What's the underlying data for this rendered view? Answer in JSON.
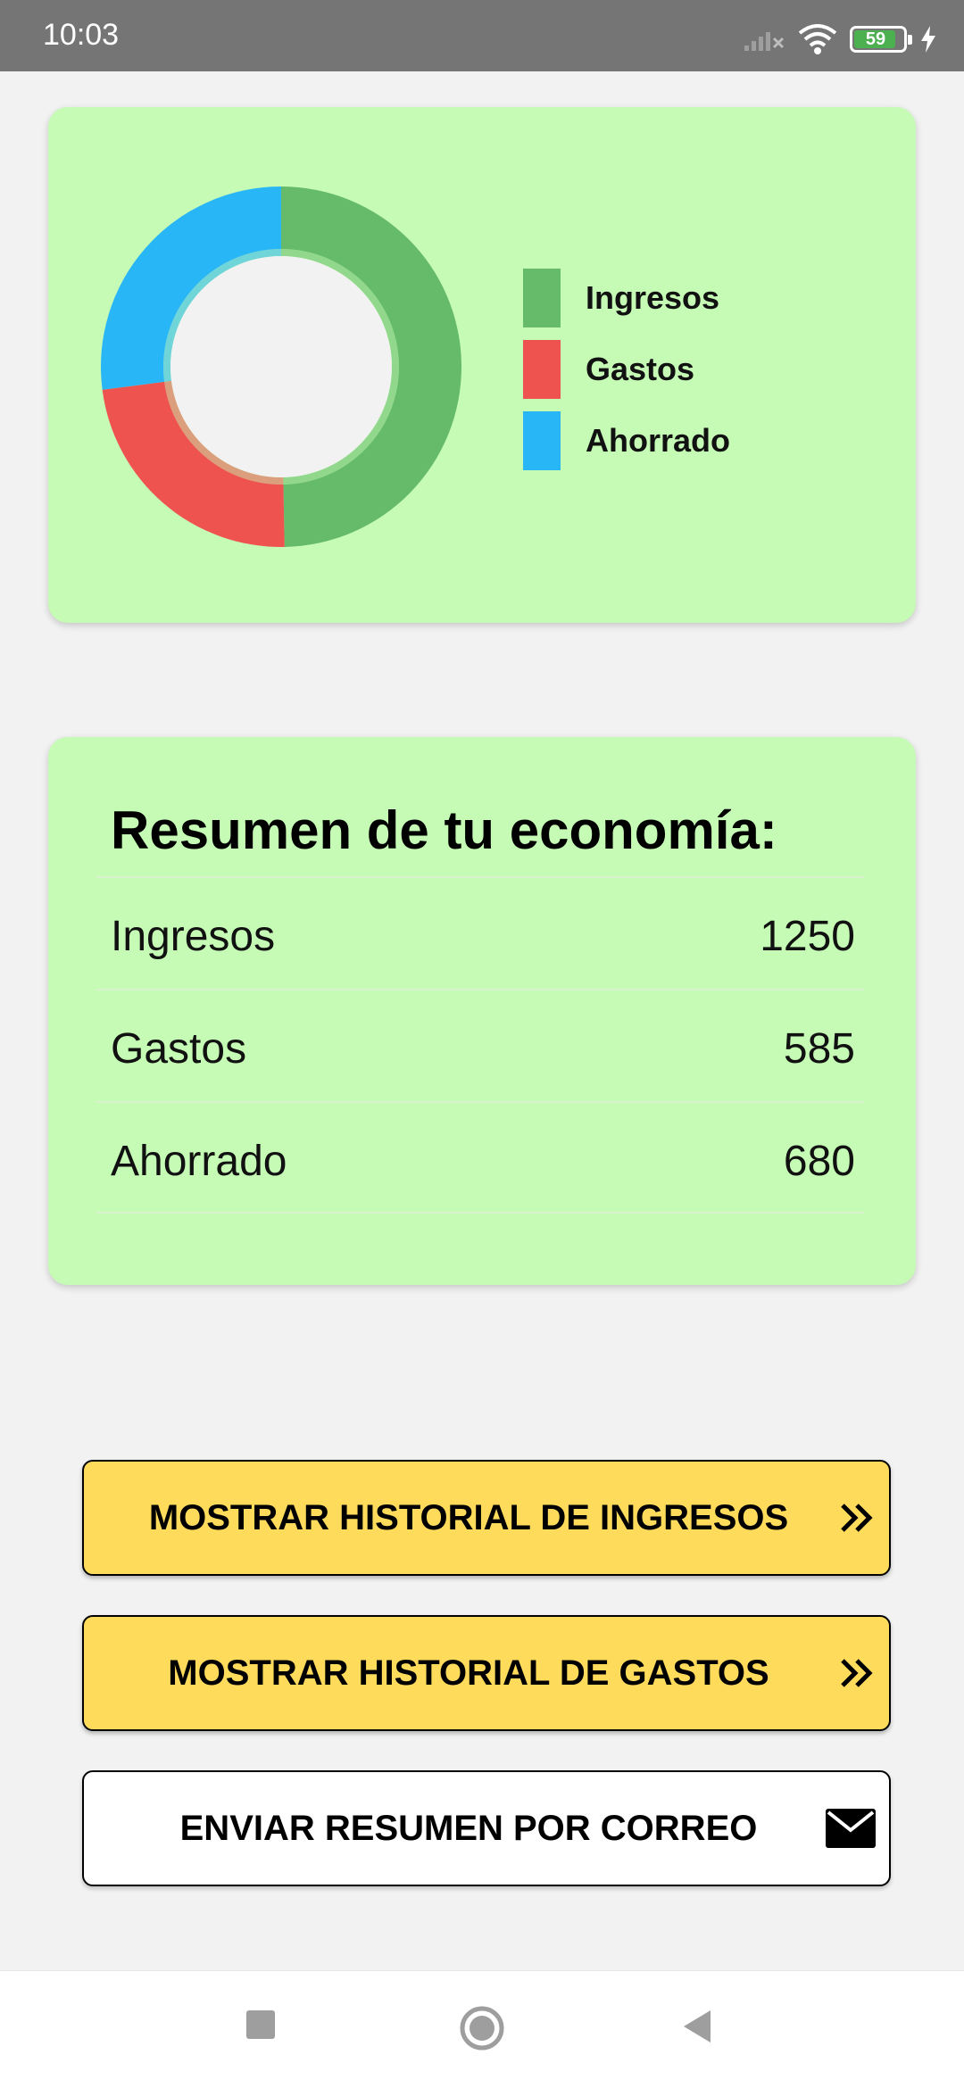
{
  "status_bar": {
    "time": "10:03",
    "battery_level": "59",
    "icons": [
      "signal-off-icon",
      "wifi-icon",
      "battery-icon",
      "charging-icon"
    ]
  },
  "chart": {
    "legend": [
      {
        "label": "Ingresos",
        "color": "#66bb6a"
      },
      {
        "label": "Gastos",
        "color": "#ef5350"
      },
      {
        "label": "Ahorrado",
        "color": "#29b6f6"
      }
    ]
  },
  "chart_data": {
    "type": "pie",
    "categories": [
      "Ingresos",
      "Gastos",
      "Ahorrado"
    ],
    "values": [
      1250,
      585,
      680
    ],
    "colors": [
      "#66bb6a",
      "#ef5350",
      "#29b6f6"
    ],
    "donut": true,
    "legend_position": "right"
  },
  "summary": {
    "title": "Resumen de tu economía:",
    "rows": [
      {
        "label": "Ingresos",
        "value": "1250"
      },
      {
        "label": "Gastos",
        "value": "585"
      },
      {
        "label": "Ahorrado",
        "value": "680"
      }
    ]
  },
  "buttons": {
    "income_history": "MOSTRAR HISTORIAL DE INGRESOS",
    "expense_history": "MOSTRAR HISTORIAL DE GASTOS",
    "send_email": "ENVIAR RESUMEN POR CORREO"
  },
  "colors": {
    "card_background": "#c5fbb5",
    "button_yellow": "#ffdb5c",
    "status_bar": "#757575",
    "page_background": "#f2f2f2"
  },
  "nav_bar": {
    "icons": [
      "recents-icon",
      "home-icon",
      "back-icon"
    ]
  }
}
